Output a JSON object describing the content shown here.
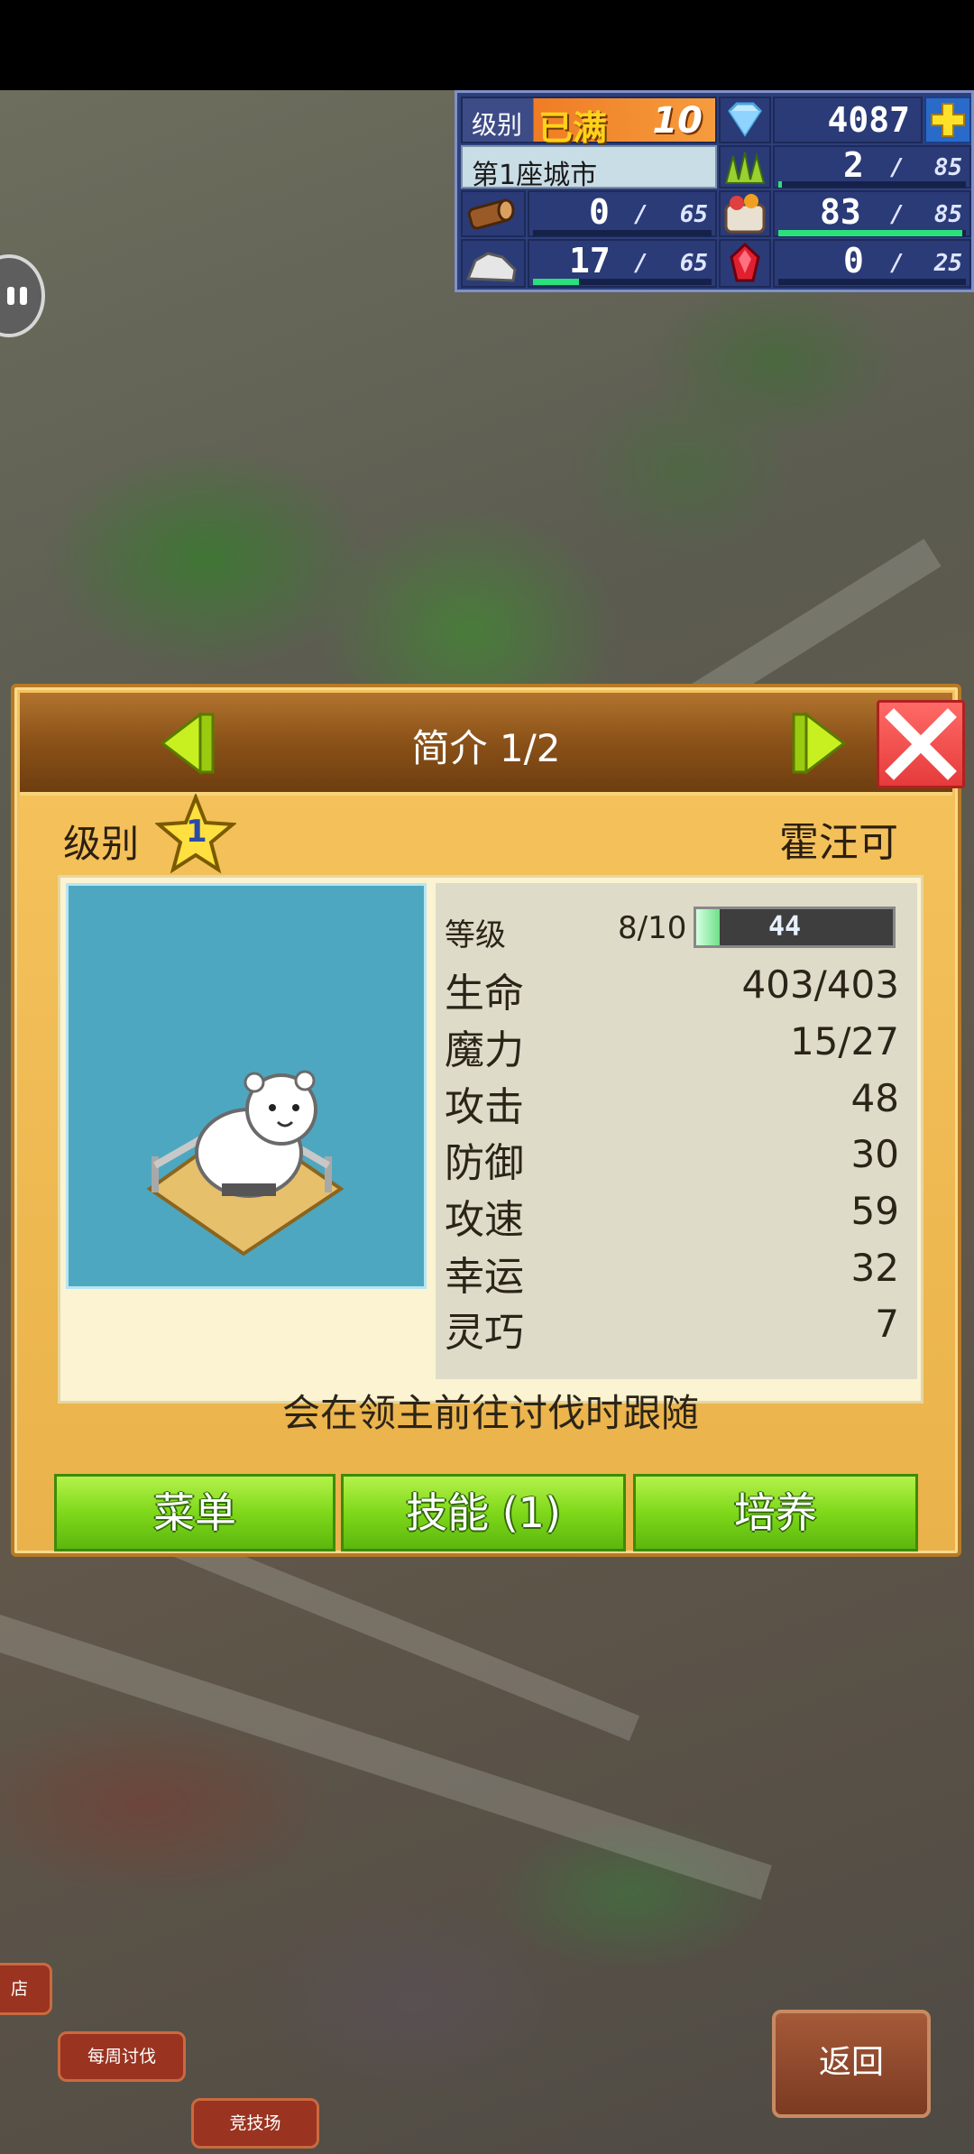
{
  "hud": {
    "level_label": "级别",
    "level_badge": "已满",
    "level_value": "10",
    "gems": "4087",
    "city_name": "第1座城市",
    "resources": [
      {
        "icon": "lumber-icon",
        "value": "0",
        "max": "65",
        "progress": 0
      },
      {
        "icon": "stone-icon",
        "value": "17",
        "max": "65",
        "progress": 0.26
      },
      {
        "icon": "grass-icon",
        "value": "2",
        "max": "85",
        "progress": 0.02
      },
      {
        "icon": "food-icon",
        "value": "83",
        "max": "85",
        "progress": 0.98
      },
      {
        "icon": "ruby-icon",
        "value": "0",
        "max": "25",
        "progress": 0
      }
    ],
    "slash": "/"
  },
  "dialog": {
    "title": "简介 1/2",
    "level_label": "级别",
    "star_level": "1",
    "name": "霍汪可",
    "grade": {
      "label": "等级",
      "value": "8/10",
      "bar_text": "44",
      "progress": 0.12
    },
    "stats": [
      {
        "label": "生命",
        "value": "403/403"
      },
      {
        "label": "魔力",
        "value": "15/27"
      },
      {
        "label": "攻击",
        "value": "48"
      },
      {
        "label": "防御",
        "value": "30"
      },
      {
        "label": "攻速",
        "value": "59"
      },
      {
        "label": "幸运",
        "value": "32"
      },
      {
        "label": "灵巧",
        "value": "7"
      }
    ],
    "description": "会在领主前往讨伐时跟随",
    "buttons": {
      "menu": "菜单",
      "skills": "技能 (1)",
      "train": "培养"
    }
  },
  "bottom": {
    "shop_partial": "店",
    "weekly": "每周讨伐",
    "arena": "竞技场",
    "back": "返回"
  }
}
